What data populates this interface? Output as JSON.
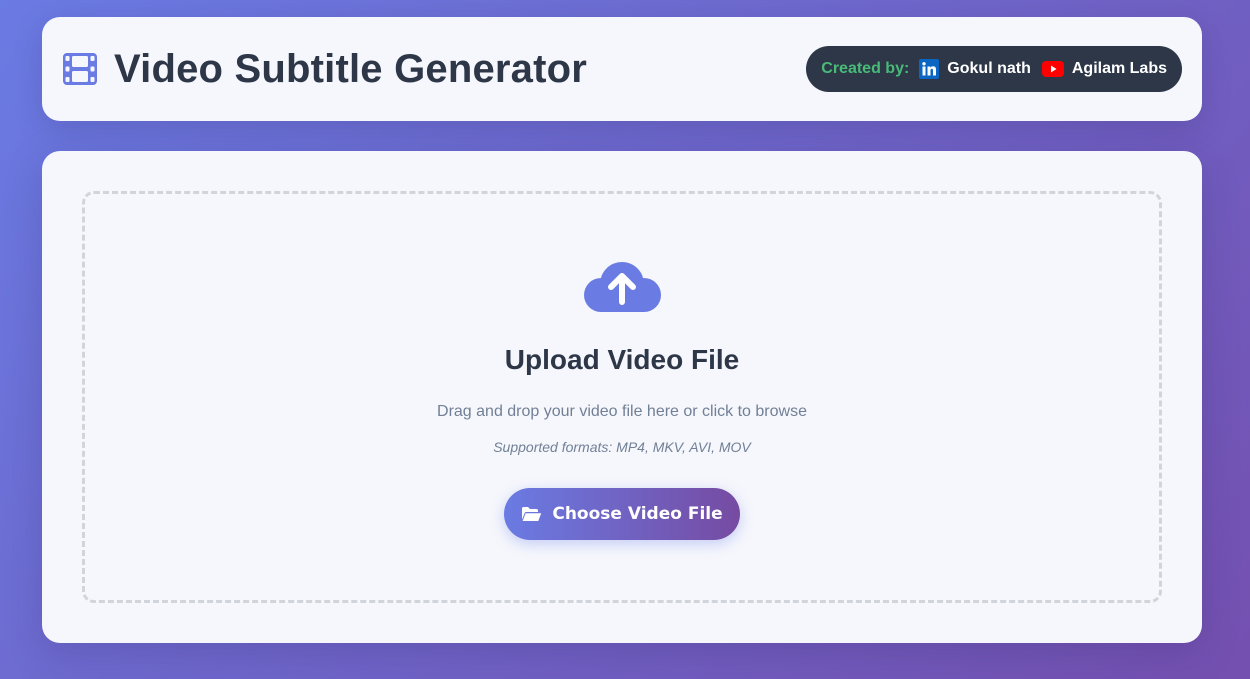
{
  "header": {
    "title": "Video Subtitle Generator",
    "icon": "film-icon",
    "credits": {
      "label": "Created by:",
      "links": [
        {
          "text": "Gokul nath",
          "icon": "linkedin-icon"
        },
        {
          "text": "Agilam Labs",
          "icon": "youtube-icon"
        }
      ]
    }
  },
  "upload": {
    "icon": "cloud-upload-icon",
    "title": "Upload Video File",
    "hint": "Drag and drop your video file here or click to browse",
    "formats": "Supported formats: MP4, MKV, AVI, MOV",
    "button_label": "Choose Video File",
    "button_icon": "folder-open-icon"
  },
  "colors": {
    "accent": "#667eea",
    "accent_end": "#764ba2",
    "heading": "#2d3748",
    "credit_label": "#48bb78",
    "linkedin": "#0a66c2",
    "youtube": "#ff0000"
  }
}
